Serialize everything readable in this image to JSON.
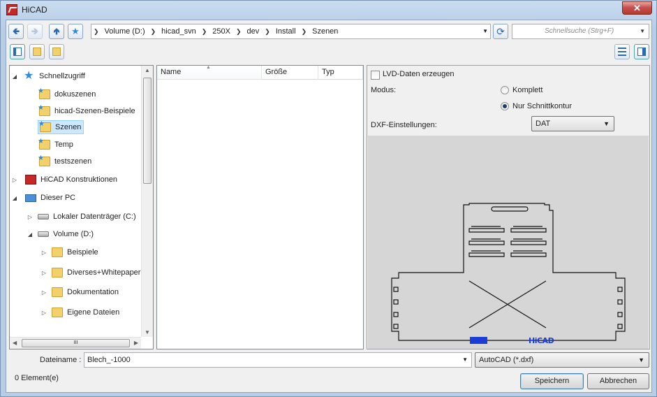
{
  "window": {
    "title": "HiCAD",
    "close_glyph": "✕"
  },
  "nav": {
    "back_icon": "arrow-left-icon",
    "forward_icon": "arrow-right-icon",
    "up_icon": "arrow-up-icon",
    "quickaccess_icon": "star-icon"
  },
  "breadcrumb": [
    "Volume (D:)",
    "hicad_svn",
    "250X",
    "dev",
    "Install",
    "Szenen"
  ],
  "search": {
    "placeholder": "Schnellsuche (Strg+F)"
  },
  "tree": {
    "items": [
      {
        "label": "Schnellzugriff",
        "icon": "star-icon",
        "level": 0,
        "expanded": true
      },
      {
        "label": "dokuszenen",
        "icon": "pinned-folder-icon",
        "level": 1
      },
      {
        "label": "hicad-Szenen-Beispiele",
        "icon": "pinned-folder-icon",
        "level": 1
      },
      {
        "label": "Szenen",
        "icon": "pinned-folder-icon",
        "level": 1,
        "selected": true
      },
      {
        "label": "Temp",
        "icon": "pinned-folder-icon",
        "level": 1
      },
      {
        "label": "testszenen",
        "icon": "pinned-folder-icon",
        "level": 1
      },
      {
        "label": "HiCAD Konstruktionen",
        "icon": "hicad-icon",
        "level": 0,
        "expanded": false
      },
      {
        "label": "Dieser PC",
        "icon": "pc-icon",
        "level": 0,
        "expanded": true
      },
      {
        "label": "Lokaler Datenträger (C:)",
        "icon": "drive-icon",
        "level": 1,
        "expanded": false
      },
      {
        "label": "Volume (D:)",
        "icon": "drive-icon",
        "level": 1,
        "expanded": true
      },
      {
        "label": "Beispiele",
        "icon": "folder-icon",
        "level": 2,
        "expanded": false
      },
      {
        "label": "Diverses+Whitepaper",
        "icon": "folder-icon",
        "level": 2,
        "expanded": false
      },
      {
        "label": "Dokumentation",
        "icon": "folder-icon",
        "level": 2,
        "expanded": false
      },
      {
        "label": "Eigene Dateien",
        "icon": "folder-icon",
        "level": 2,
        "expanded": false
      }
    ],
    "hscroll_grip": "III"
  },
  "filelist": {
    "columns": [
      "Name",
      "Größe",
      "Typ"
    ]
  },
  "settings": {
    "lvd_label": "LVD-Daten erzeugen",
    "lvd_checked": false,
    "modus_label": "Modus:",
    "modus_options": [
      "Komplett",
      "Nur Schnittkontur"
    ],
    "modus_selected": "Nur Schnittkontur",
    "dxf_label": "DXF-Einstellungen:",
    "dxf_value": "DAT",
    "preview_logo": "HiCAD"
  },
  "bottom": {
    "filename_label": "Dateiname :",
    "filename_value": "Blech_-1000",
    "filetype_value": "AutoCAD (*.dxf)",
    "count_text": "0  Element(e)",
    "save_label": "Speichern",
    "cancel_label": "Abbrechen"
  },
  "colors": {
    "accent": "#2a6ab3",
    "selection": "#cce8ff"
  }
}
